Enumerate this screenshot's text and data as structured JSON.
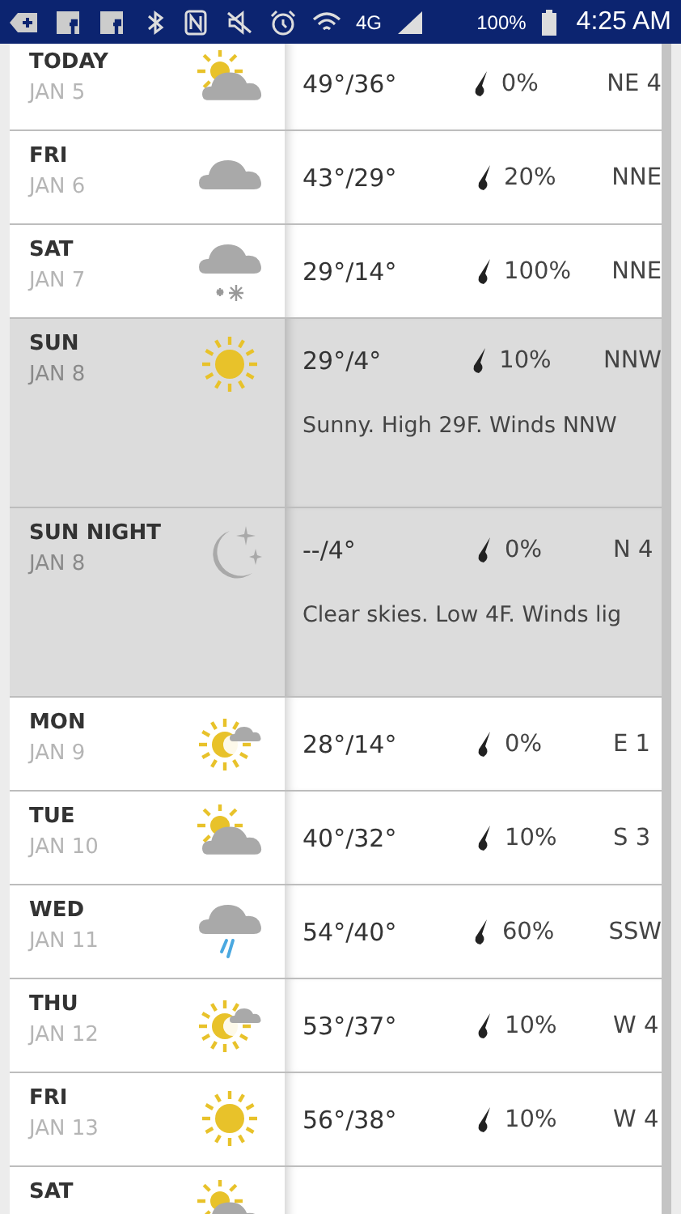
{
  "status_bar": {
    "network": "4G",
    "battery": "100%",
    "time": "4:25 AM"
  },
  "days": [
    {
      "day": "TODAY",
      "date": "JAN 5",
      "kind": "partly_cloudy",
      "temp": "49°/36°",
      "precip": "0%",
      "wind": "NE 4",
      "expanded": false
    },
    {
      "day": "FRI",
      "date": "JAN 6",
      "kind": "cloudy",
      "temp": "43°/29°",
      "precip": "20%",
      "wind": "NNE",
      "expanded": false
    },
    {
      "day": "SAT",
      "date": "JAN 7",
      "kind": "snow",
      "temp": "29°/14°",
      "precip": "100%",
      "wind": "NNE",
      "expanded": false
    },
    {
      "day": "SUN",
      "date": "JAN 8",
      "kind": "sunny",
      "temp": "29°/4°",
      "precip": "10%",
      "wind": "NNW",
      "expanded": true,
      "description": "Sunny. High 29F. Winds NNW"
    },
    {
      "day": "SUN NIGHT",
      "date": "JAN 8",
      "kind": "clear_night",
      "temp": "--/4°",
      "precip": "0%",
      "wind": "N 4",
      "expanded": true,
      "description": "Clear skies. Low 4F. Winds lig"
    },
    {
      "day": "MON",
      "date": "JAN 9",
      "kind": "mostly_sunny",
      "temp": "28°/14°",
      "precip": "0%",
      "wind": "E 1",
      "expanded": false
    },
    {
      "day": "TUE",
      "date": "JAN 10",
      "kind": "partly_cloudy",
      "temp": "40°/32°",
      "precip": "10%",
      "wind": "S 3",
      "expanded": false
    },
    {
      "day": "WED",
      "date": "JAN 11",
      "kind": "rain",
      "temp": "54°/40°",
      "precip": "60%",
      "wind": "SSW",
      "expanded": false
    },
    {
      "day": "THU",
      "date": "JAN 12",
      "kind": "mostly_sunny",
      "temp": "53°/37°",
      "precip": "10%",
      "wind": "W 4",
      "expanded": false
    },
    {
      "day": "FRI",
      "date": "JAN 13",
      "kind": "sunny",
      "temp": "56°/38°",
      "precip": "10%",
      "wind": "W 4",
      "expanded": false
    },
    {
      "day": "SAT",
      "kind": "partly_cloudy",
      "expanded": false
    }
  ]
}
